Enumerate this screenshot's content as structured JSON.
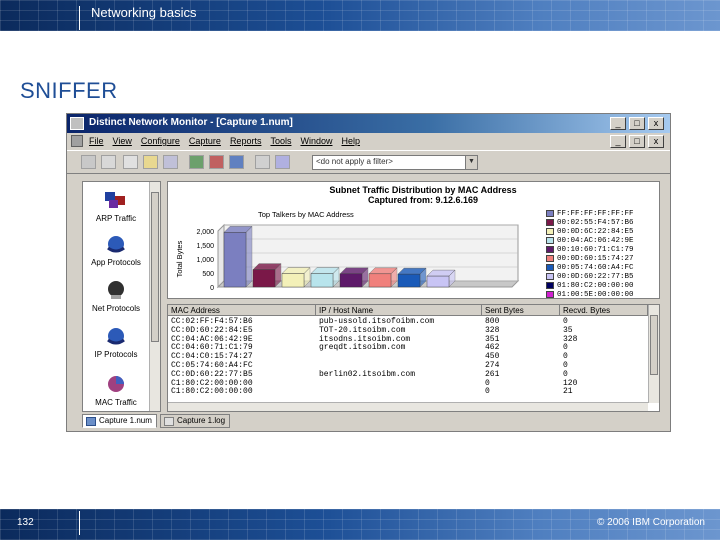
{
  "header": {
    "title": "Networking basics"
  },
  "slide": {
    "heading": "SNIFFER",
    "page_number": "132",
    "copyright": "© 2006 IBM Corporation"
  },
  "app": {
    "window_title": "Distinct Network Monitor - [Capture 1.num]",
    "window_buttons": [
      "_",
      "□",
      "x"
    ],
    "mdi_buttons": [
      "_",
      "□",
      "x"
    ],
    "menu": [
      "File",
      "View",
      "Configure",
      "Capture",
      "Reports",
      "Tools",
      "Window",
      "Help"
    ],
    "filter": {
      "value": "<do not apply a filter>"
    },
    "left_pane": [
      {
        "label": "ARP Traffic",
        "icon": "arp-traffic-icon"
      },
      {
        "label": "App Protocols",
        "icon": "app-protocols-icon"
      },
      {
        "label": "Net Protocols",
        "icon": "net-protocols-icon"
      },
      {
        "label": "IP Protocols",
        "icon": "ip-protocols-icon"
      },
      {
        "label": "MAC Traffic",
        "icon": "mac-traffic-icon"
      }
    ],
    "chart_header": {
      "line1": "Subnet Traffic Distribution by MAC Address",
      "line2": "Captured from: 9.12.6.169"
    },
    "tabs": [
      "Capture 1.num",
      "Capture 1.log"
    ],
    "table": {
      "columns": [
        "MAC Address",
        "IP / Host Name",
        "Sent Bytes",
        "Recvd. Bytes"
      ],
      "rows": [
        [
          "CC:02:FF:F4:57:B6",
          "pub-ussold.itsofoibm.com",
          "800",
          "0"
        ],
        [
          "CC:0D:60:22:84:E5",
          "TOT-20.itsoibm.com",
          "328",
          "35"
        ],
        [
          "CC:04:AC:06:42:9E",
          "itsodns.itsoibm.com",
          "351",
          "328"
        ],
        [
          "CC:04:60:71:C1:79",
          "greqdt.itsoibm.com",
          "462",
          "0"
        ],
        [
          "CC:04:C0:15:74:27",
          "",
          "450",
          "0"
        ],
        [
          "CC:05:74:60:A4:FC",
          "",
          "274",
          "0"
        ],
        [
          "CC:0D:60:22:77:B5",
          "berlin02.itsoibm.com",
          "261",
          "0"
        ],
        [
          "C1:80:C2:00:00:00",
          "",
          "0",
          "120"
        ],
        [
          "C1:80:C2:00:00:00",
          "",
          "0",
          "21"
        ]
      ]
    }
  },
  "chart_data": {
    "type": "bar",
    "title": "Top Talkers by MAC Address",
    "ylabel": "Total Bytes",
    "xlabel": "",
    "ylim": [
      0,
      2000
    ],
    "yticks": [
      "2,000",
      "1,500",
      "1,000",
      "500",
      "0"
    ],
    "categories": [
      "FF:FF:FF:FF:FF:FF",
      "00:02:55:F4:57:B6",
      "00:0D:6C:22:84:E5",
      "00:04:AC:06:42:9E",
      "00:10:60:71:C1:79",
      "00:0D:60:15:74:27",
      "00:05:74:60:A4:FC",
      "00:0D:60:22:77:B5",
      "01:80:C2:00:00:00",
      "01:00:5E:00:00:00"
    ],
    "values": [
      1950,
      620,
      480,
      480,
      470,
      470,
      460,
      390,
      0,
      0
    ],
    "colors": [
      "#7b7fc0",
      "#7a1848",
      "#f3f0b8",
      "#b8e4ec",
      "#5e1a6a",
      "#f0807c",
      "#1a5ab8",
      "#c8c4f4",
      "#000060",
      "#d020d0"
    ],
    "legend_position": "right"
  }
}
